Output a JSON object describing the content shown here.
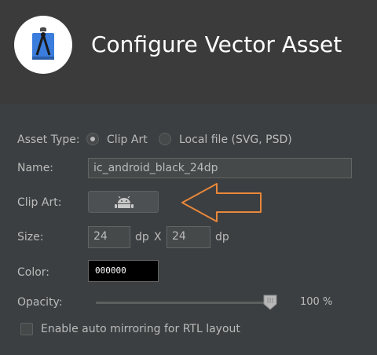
{
  "header": {
    "title": "Configure Vector Asset",
    "logo_icon": "android-studio-logo-icon"
  },
  "form": {
    "asset_type_label": "Asset Type:",
    "radio_clip_art": "Clip Art",
    "radio_local_file": "Local file (SVG, PSD)",
    "selected_asset_type": "Clip Art",
    "name_label": "Name:",
    "name_value": "ic_android_black_24dp",
    "clip_art_label": "Clip Art:",
    "clip_art_icon": "android-robot-icon",
    "size_label": "Size:",
    "width_value": "24",
    "height_value": "24",
    "unit_dp": "dp",
    "size_separator": "X",
    "color_label": "Color:",
    "color_value": "000000",
    "opacity_label": "Opacity:",
    "opacity_value": "100 %",
    "opacity_fraction": 1.0,
    "rtl_checkbox_label": "Enable auto mirroring for RTL layout",
    "rtl_checked": false
  },
  "annotation": {
    "arrow_color": "#e8873a",
    "arrow_icon": "left-arrow-annotation"
  },
  "colors": {
    "background": "#3c3f41",
    "header": "#3b3b3b",
    "text": "#bbbbbb"
  }
}
